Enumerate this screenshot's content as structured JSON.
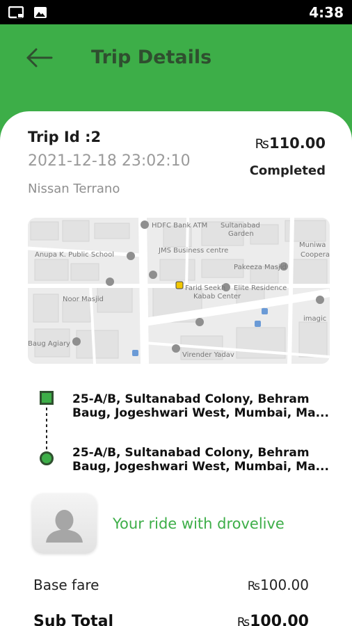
{
  "status_bar": {
    "time": "4:38",
    "icons": [
      "screen-cast-icon",
      "image-icon"
    ]
  },
  "header": {
    "title": "Trip Details",
    "back_icon": "arrow-left-icon"
  },
  "trip": {
    "id_label": "Trip Id :2",
    "datetime": "2021-12-18 23:02:10",
    "vehicle": "Nissan Terrano",
    "currency": "₨",
    "amount": "110.00",
    "status": "Completed"
  },
  "map": {
    "labels": {
      "hdfc": "HDFC Bank ATM",
      "sultanabad": "Sultanabad",
      "garden": "Garden",
      "anupa": "Anupa K. Public School",
      "jms": "JMS Business centre",
      "pakeeza": "Pakeeza Masjid",
      "muniwar": "Muniwa",
      "cooper": "Coopera",
      "noor": "Noor Masjid",
      "fariid": "Farid Seekh",
      "kabab": "Kabab Center",
      "elite": "Elite Residence",
      "imagic": "imagic",
      "baug": "Baug Agiary",
      "virender": "Virender Yadav"
    }
  },
  "route": {
    "pickup": {
      "line1": "25-A/B, Sultanabad Colony, Behram",
      "line2": "Baug, Jogeshwari West, Mumbai, Ma..."
    },
    "dropoff": {
      "line1": "25-A/B, Sultanabad Colony, Behram",
      "line2": "Baug, Jogeshwari West, Mumbai, Ma..."
    }
  },
  "driver": {
    "avatar_icon": "person-silhouette-icon",
    "ride_text": "Your ride with drovelive"
  },
  "fare": {
    "base_label": "Base fare",
    "base_currency": "₨",
    "base_value": "100.00",
    "subtotal_label": "Sub Total",
    "subtotal_currency": "₨",
    "subtotal_value": "100.00"
  },
  "colors": {
    "brand_green": "#3dae48",
    "dark_green": "#2f4f2f"
  }
}
